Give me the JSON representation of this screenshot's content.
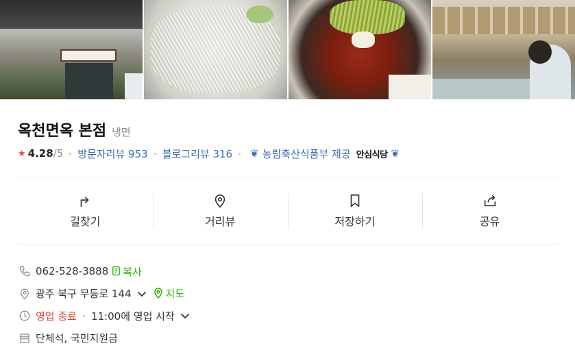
{
  "place": {
    "name": "옥천면옥 본점",
    "category": "냉면"
  },
  "rating": {
    "score": "4.28",
    "max": "/5",
    "star_color": "#e8443a"
  },
  "reviews": {
    "visitor": "방문자리뷰 953",
    "blog": "블로그리뷰 316"
  },
  "certification": {
    "text": "농림축산식품부 제공",
    "badge": "안심식당"
  },
  "actions": [
    {
      "label": "길찾기",
      "icon": "directions-icon"
    },
    {
      "label": "거리뷰",
      "icon": "location-pin-icon"
    },
    {
      "label": "저장하기",
      "icon": "bookmark-icon"
    },
    {
      "label": "공유",
      "icon": "share-icon"
    }
  ],
  "details": {
    "phone": "062-528-3888",
    "copy_label": "복사",
    "address": "광주 북구 무등로 144",
    "map_label": "지도",
    "hours_status": "영업 종료",
    "hours_next": "11:00에 영업 시작",
    "amenities": "단체석, 국민지원금"
  },
  "colors": {
    "link": "#3c6ab5",
    "green": "#2db400",
    "closed_red": "#e2463b"
  }
}
